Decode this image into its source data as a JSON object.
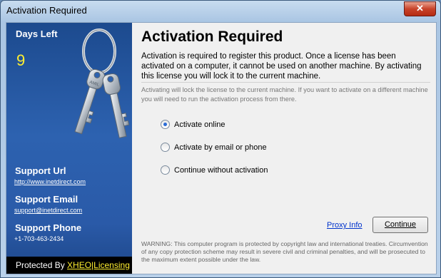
{
  "window": {
    "title": "Activation Required",
    "close_label": "✕"
  },
  "sidebar": {
    "days_left_label": "Days Left",
    "days_left_value": "9",
    "support_url_label": "Support Url",
    "support_url_value": "http://www.inetdirect.com",
    "support_email_label": "Support Email",
    "support_email_value": "support@inetdirect.com",
    "support_phone_label": "Support Phone",
    "support_phone_value": "+1-703-463-2434",
    "protected_by": "Protected By",
    "protected_brand": "XHEO|Licensing",
    "key_text": "AMIL",
    "brand_color": "#2d62b0",
    "accent_color": "#ffef30"
  },
  "main": {
    "heading": "Activation Required",
    "description": "Activation is required to register this product. Once a license has been activated on a computer, it cannot be used on another machine. By activating this license you will lock it to the current machine.",
    "sub_description": "Activating will lock the license to the current machine. If you want to activate on a different machine you will need to run the activation process from there.",
    "options": [
      {
        "label": "Activate online",
        "selected": true
      },
      {
        "label": "Activate by email or phone",
        "selected": false
      },
      {
        "label": "Continue without activation",
        "selected": false
      }
    ],
    "proxy_link": "Proxy Info",
    "continue_label": "Continue",
    "warning": "WARNING: This computer program is protected by copyright law and international treaties. Circumvention of any copy protection scheme may result in severe civil and criminal penalties, and will be prosecuted to the maximum extent possible under the law."
  }
}
